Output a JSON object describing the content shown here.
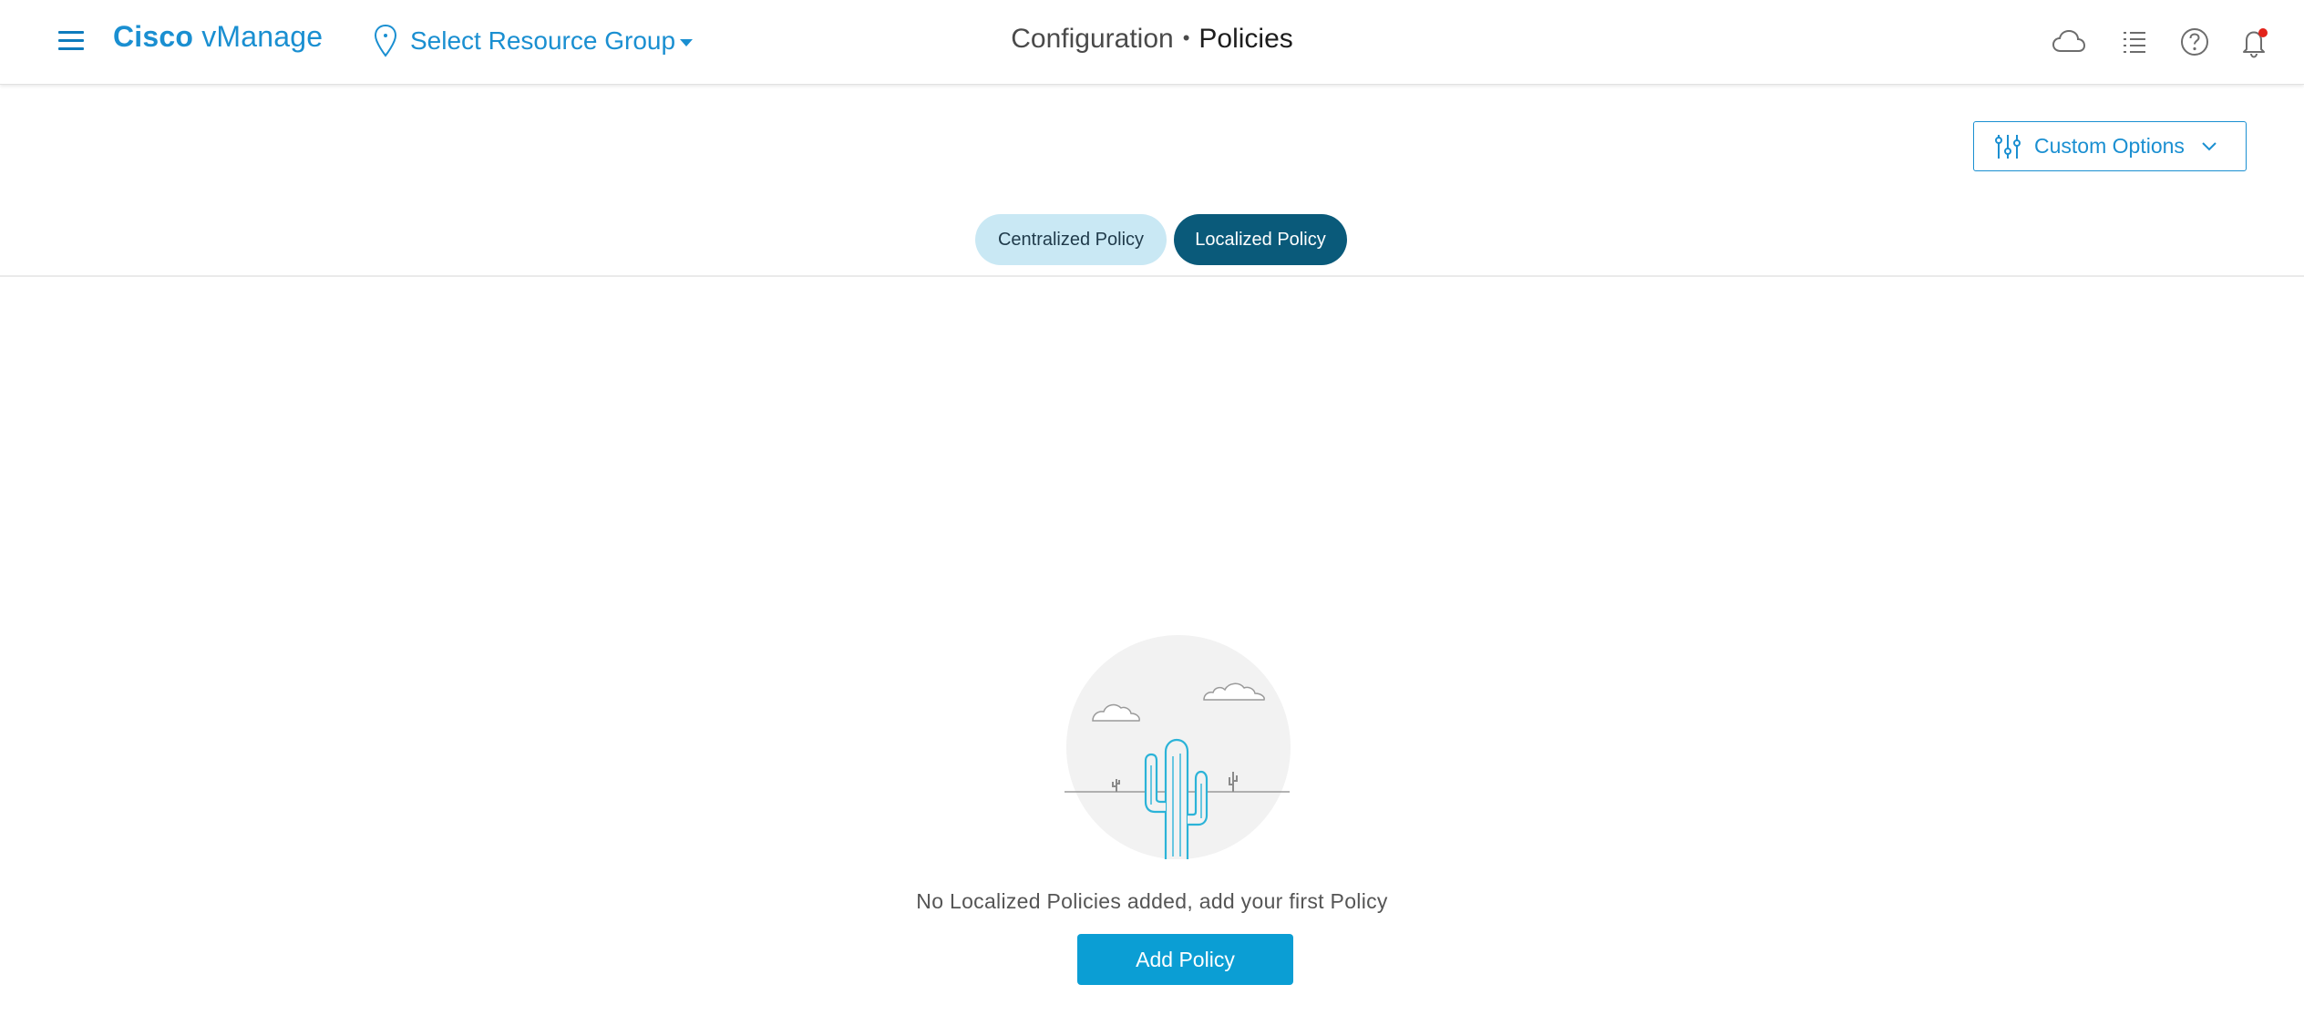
{
  "header": {
    "brand_bold": "Cisco",
    "brand_rest": "vManage",
    "resource_group_label": "Select Resource Group",
    "breadcrumb": {
      "section": "Configuration",
      "separator": "•",
      "current": "Policies"
    },
    "icons": [
      "menu-icon",
      "location-pin-icon",
      "cloud-icon",
      "task-list-icon",
      "help-icon",
      "notification-bell-icon"
    ],
    "notification_dot_color": "#e2231a",
    "accent_color": "#1a8fd1"
  },
  "toolbar": {
    "custom_options_label": "Custom Options"
  },
  "tabs": [
    {
      "label": "Centralized Policy",
      "active": false
    },
    {
      "label": "Localized Policy",
      "active": true
    }
  ],
  "empty_state": {
    "illustration": "desert-cactus-illustration",
    "message": "No Localized Policies added, add your first Policy",
    "button_label": "Add Policy"
  },
  "colors": {
    "active_tab_bg": "#0a5a7a",
    "inactive_tab_bg": "#c9e8f4",
    "primary_button_bg": "#0b9ed4"
  }
}
